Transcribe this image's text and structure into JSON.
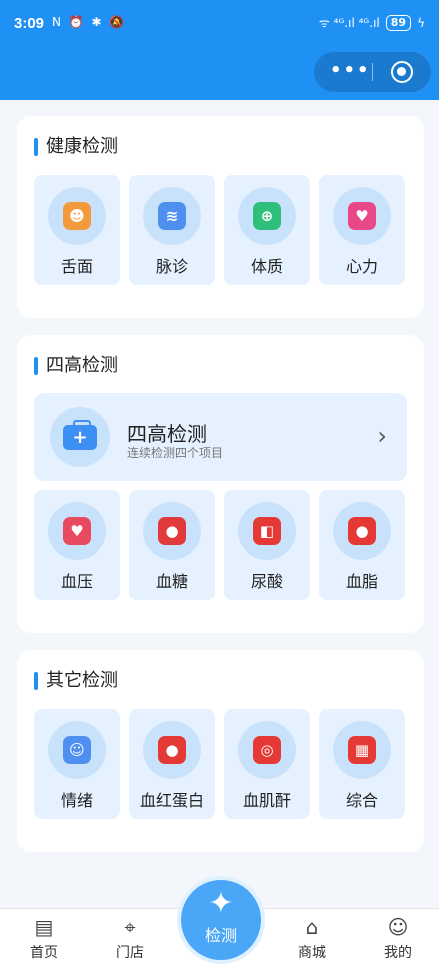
{
  "status": {
    "time": "3:09",
    "left_icons": "N ⏰ ✱ 🔕",
    "signal": "ᯤ ⁴ᴳ.ıl ⁴ᴳ.ıl",
    "battery": "89"
  },
  "capsule": {
    "more_icon": "more-dots-icon",
    "close_icon": "target-icon"
  },
  "health": {
    "title": "健康检测",
    "items": [
      {
        "label": "舌面",
        "glyph": "☻",
        "color": "#f39b3c"
      },
      {
        "label": "脉诊",
        "glyph": "≋",
        "color": "#4f8ff0"
      },
      {
        "label": "体质",
        "glyph": "⊕",
        "color": "#2ebf7a"
      },
      {
        "label": "心力",
        "glyph": "♥",
        "color": "#e8488a"
      }
    ]
  },
  "four_high": {
    "title": "四高检测",
    "banner": {
      "title": "四高检测",
      "subtitle": "连续检测四个项目",
      "chevron": "›",
      "icon": "+"
    },
    "items": [
      {
        "label": "血压",
        "glyph": "♥",
        "color": "#e84a5f"
      },
      {
        "label": "血糖",
        "glyph": "●",
        "color": "#e03a3a"
      },
      {
        "label": "尿酸",
        "glyph": "◧",
        "color": "#e53935"
      },
      {
        "label": "血脂",
        "glyph": "●",
        "color": "#e53935"
      }
    ]
  },
  "other": {
    "title": "其它检测",
    "items": [
      {
        "label": "情绪",
        "glyph": "☺",
        "color": "#4f8ff0"
      },
      {
        "label": "血红蛋白",
        "glyph": "●",
        "color": "#e53935"
      },
      {
        "label": "血肌酐",
        "glyph": "◎",
        "color": "#e53935"
      },
      {
        "label": "综合",
        "glyph": "▦",
        "color": "#e53935"
      }
    ]
  },
  "tabbar": {
    "items": [
      {
        "label": "首页",
        "glyph": "▤"
      },
      {
        "label": "门店",
        "glyph": "⌖"
      },
      {
        "label": "商城",
        "glyph": "⌂"
      },
      {
        "label": "我的",
        "glyph": "☺"
      }
    ],
    "center": {
      "label": "检测",
      "glyph": "✦"
    }
  }
}
